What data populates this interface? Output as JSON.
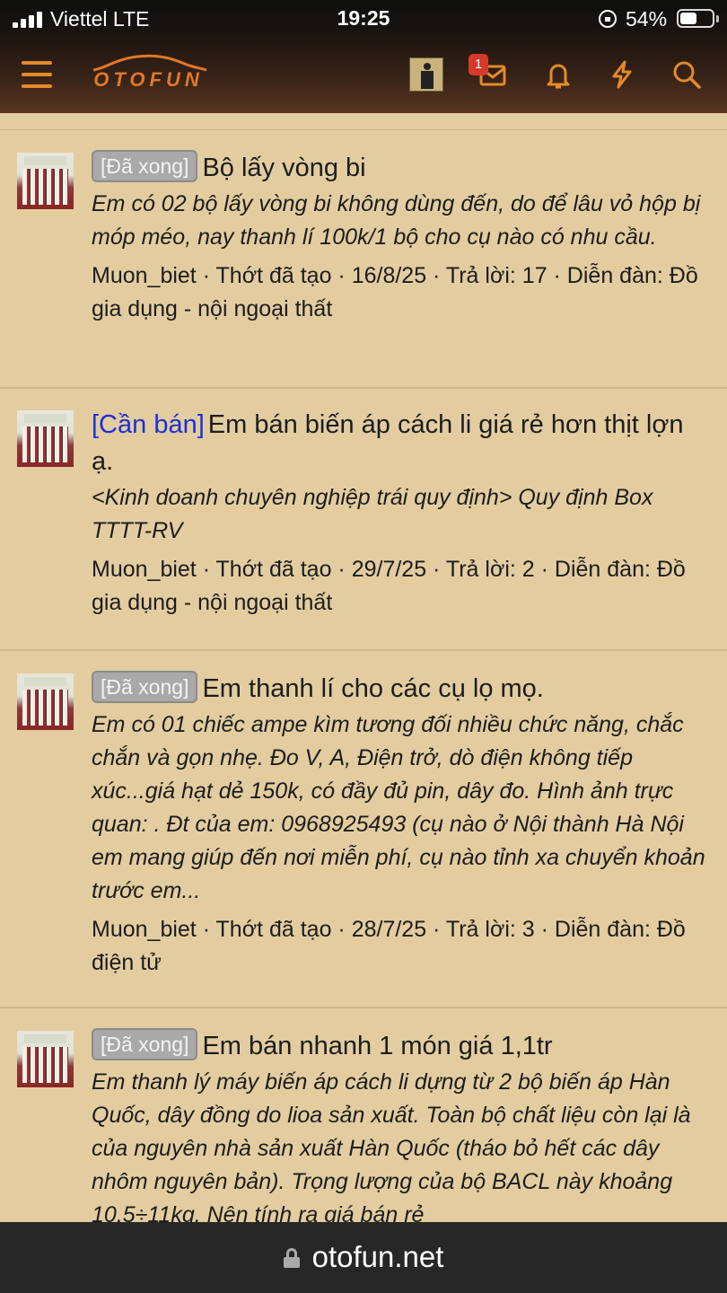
{
  "status_bar": {
    "carrier": "Viettel  LTE",
    "time": "19:25",
    "battery": "54%",
    "battery_level": 0.54
  },
  "header": {
    "logo": "OTOFUN",
    "notification_count": "1"
  },
  "threads": [
    {
      "prefix": "[Đã xong]",
      "prefix_style": "badge",
      "title": "Bộ lấy vòng bi",
      "snippet": "Em có 02 bộ lấy vòng bi không dùng đến, do để lâu vỏ hộp bị móp méo, nay thanh lí 100k/1 bộ cho cụ nào có nhu cầu.",
      "meta": "Muon_biet · Thớt đã tạo · 16/8/25 · Trả lời: 17 · Diễn đàn: Đồ gia dụng - nội ngoại thất"
    },
    {
      "prefix": "[Cần bán]",
      "prefix_style": "link",
      "title": "Em bán biến áp cách li giá rẻ hơn thịt lợn ạ.",
      "snippet": "<Kinh doanh chuyên nghiệp trái quy định> Quy định Box TTTT-RV",
      "meta": "Muon_biet · Thớt đã tạo · 29/7/25 · Trả lời: 2 · Diễn đàn: Đồ gia dụng - nội ngoại thất"
    },
    {
      "prefix": "[Đã xong]",
      "prefix_style": "badge",
      "title": "Em thanh lí cho các cụ lọ mọ.",
      "snippet": "Em có 01 chiếc ampe kìm tương đối nhiều chức năng, chắc chắn và gọn nhẹ. Đo V, A, Điện trở, dò điện không tiếp xúc...giá hạt dẻ 150k, có đầy đủ pin, dây đo. Hình ảnh trực quan: . Đt của em: 0968925493 (cụ nào ở Nội thành Hà Nội em mang giúp đến nơi miễn phí, cụ nào tỉnh xa chuyển khoản trước em...",
      "meta": "Muon_biet · Thớt đã tạo · 28/7/25 · Trả lời: 3 · Diễn đàn: Đồ điện tử"
    },
    {
      "prefix": "[Đã xong]",
      "prefix_style": "badge",
      "title": "Em bán nhanh 1 món giá 1,1tr",
      "snippet": "Em thanh lý máy biến áp cách li dựng từ 2 bộ biến áp Hàn Quốc, dây đồng do lioa sản xuất. Toàn bộ chất liệu còn lại là của nguyên nhà sản xuất Hàn Quốc (tháo bỏ hết các dây nhôm nguyên bản). Trọng lượng của bộ BACL này khoảng 10,5÷11kg. Nên tính ra giá bán rẻ",
      "meta": ""
    }
  ],
  "bottom_bar": {
    "url": "otofun.net"
  },
  "colors": {
    "accent": "#e58a2a",
    "background": "#e3cda0",
    "badge": "#d63a2a",
    "link": "#1b2fd8"
  }
}
